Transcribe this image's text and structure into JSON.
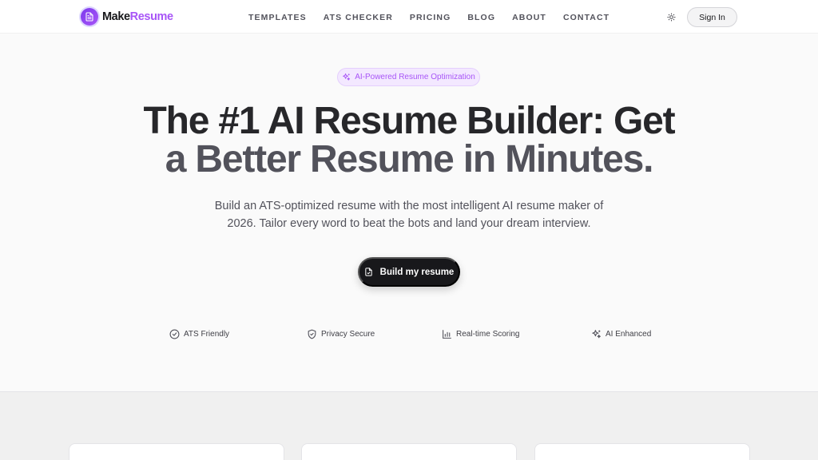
{
  "brand": {
    "name_part1": "Make",
    "name_part2": "Resume",
    "accent": "#a855f7",
    "logo_icon": "document-icon"
  },
  "nav": {
    "links": [
      "TEMPLATES",
      "ATS CHECKER",
      "PRICING",
      "BLOG",
      "ABOUT",
      "CONTACT"
    ],
    "theme_toggle_icon": "sun-icon",
    "signin_label": "Sign In"
  },
  "hero": {
    "badge_label": "AI-Powered Resume Optimization",
    "badge_icon": "sparkles-icon",
    "title_line1": "The #1 AI Resume Builder: Get",
    "title_line2": "a Better Resume in Minutes.",
    "subtitle_line1": "Build an ATS-optimized resume with the most intelligent AI resume maker of",
    "subtitle_line2": "2026. Tailor every word to beat the bots and land your dream interview.",
    "cta_label": "Build my resume",
    "cta_icon": "file-icon"
  },
  "features": [
    {
      "label": "ATS Friendly",
      "icon": "check-circle-icon"
    },
    {
      "label": "Privacy Secure",
      "icon": "shield-icon"
    },
    {
      "label": "Real-time Scoring",
      "icon": "bar-chart-icon"
    },
    {
      "label": "AI Enhanced",
      "icon": "sparkles-icon"
    }
  ]
}
